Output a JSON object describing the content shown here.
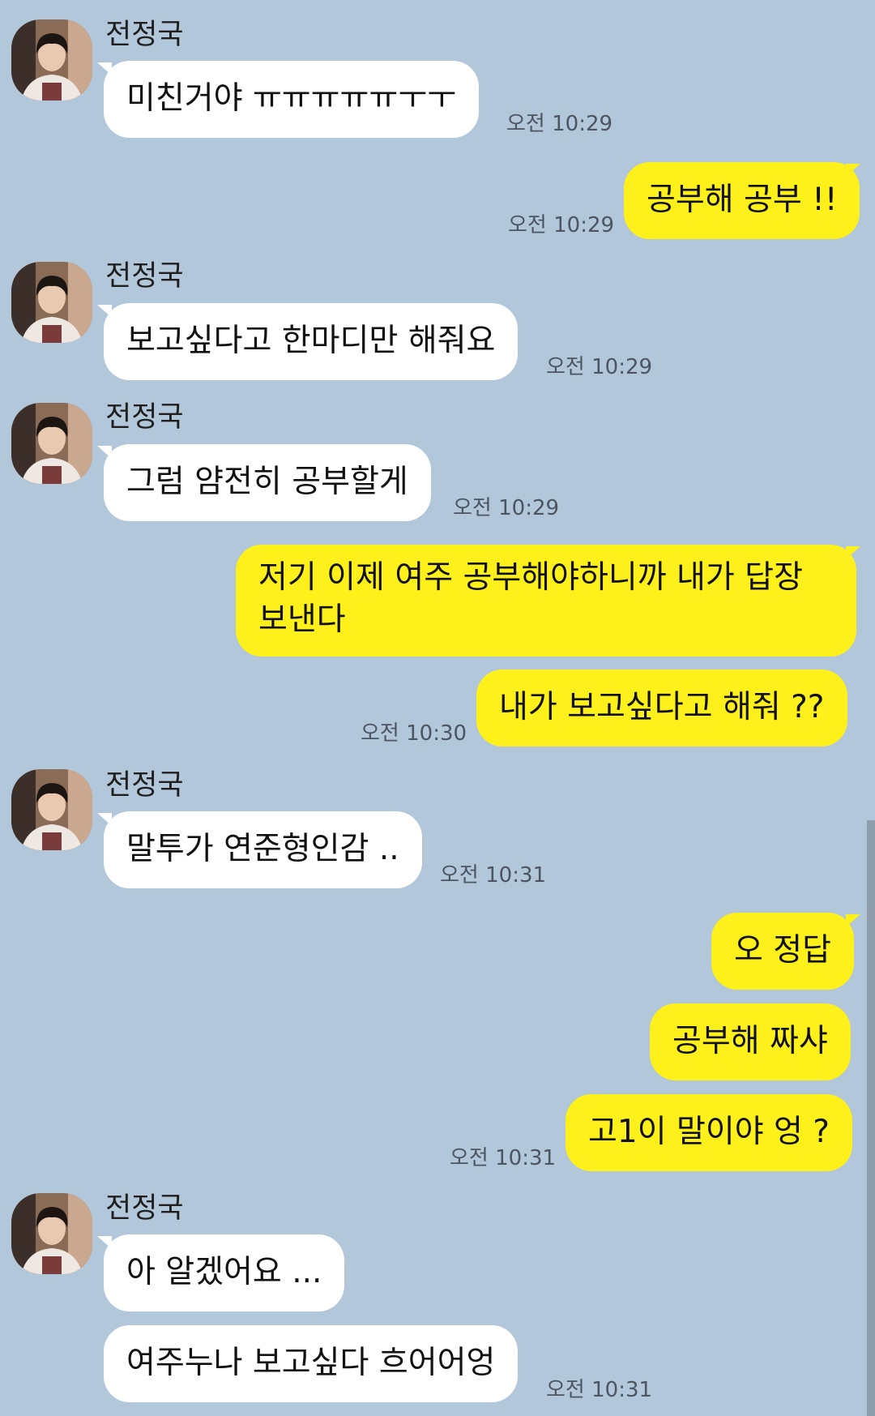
{
  "chat": {
    "sender_name": "전정국",
    "messages": [
      {
        "text": "미친거야 ㅠㅠㅠㅠㅠㅜㅜ",
        "time": "오전 10:29"
      },
      {
        "text": "공부해 공부 !!",
        "time": "오전 10:29"
      },
      {
        "text": "보고싶다고 한마디만 해줘요",
        "time": "오전 10:29"
      },
      {
        "text": "그럼 얌전히 공부할게",
        "time": "오전 10:29"
      },
      {
        "text": "저기 이제 여주 공부해야하니까 내가 답장 보낸다"
      },
      {
        "text": "내가 보고싶다고 해줘 ??",
        "time": "오전 10:30"
      },
      {
        "text": "말투가 연준형인감 ..",
        "time": "오전 10:31"
      },
      {
        "text": "오 정답"
      },
      {
        "text": "공부해 짜샤"
      },
      {
        "text": "고1이 말이야 엉 ?",
        "time": "오전 10:31"
      },
      {
        "text": "아 알겠어요 ..."
      },
      {
        "text": "여주누나 보고싶다 흐어어엉",
        "time": "오전 10:31"
      }
    ]
  },
  "colors": {
    "background": "#b2c7da",
    "incoming_bubble": "#ffffff",
    "outgoing_bubble": "#fef01b"
  }
}
